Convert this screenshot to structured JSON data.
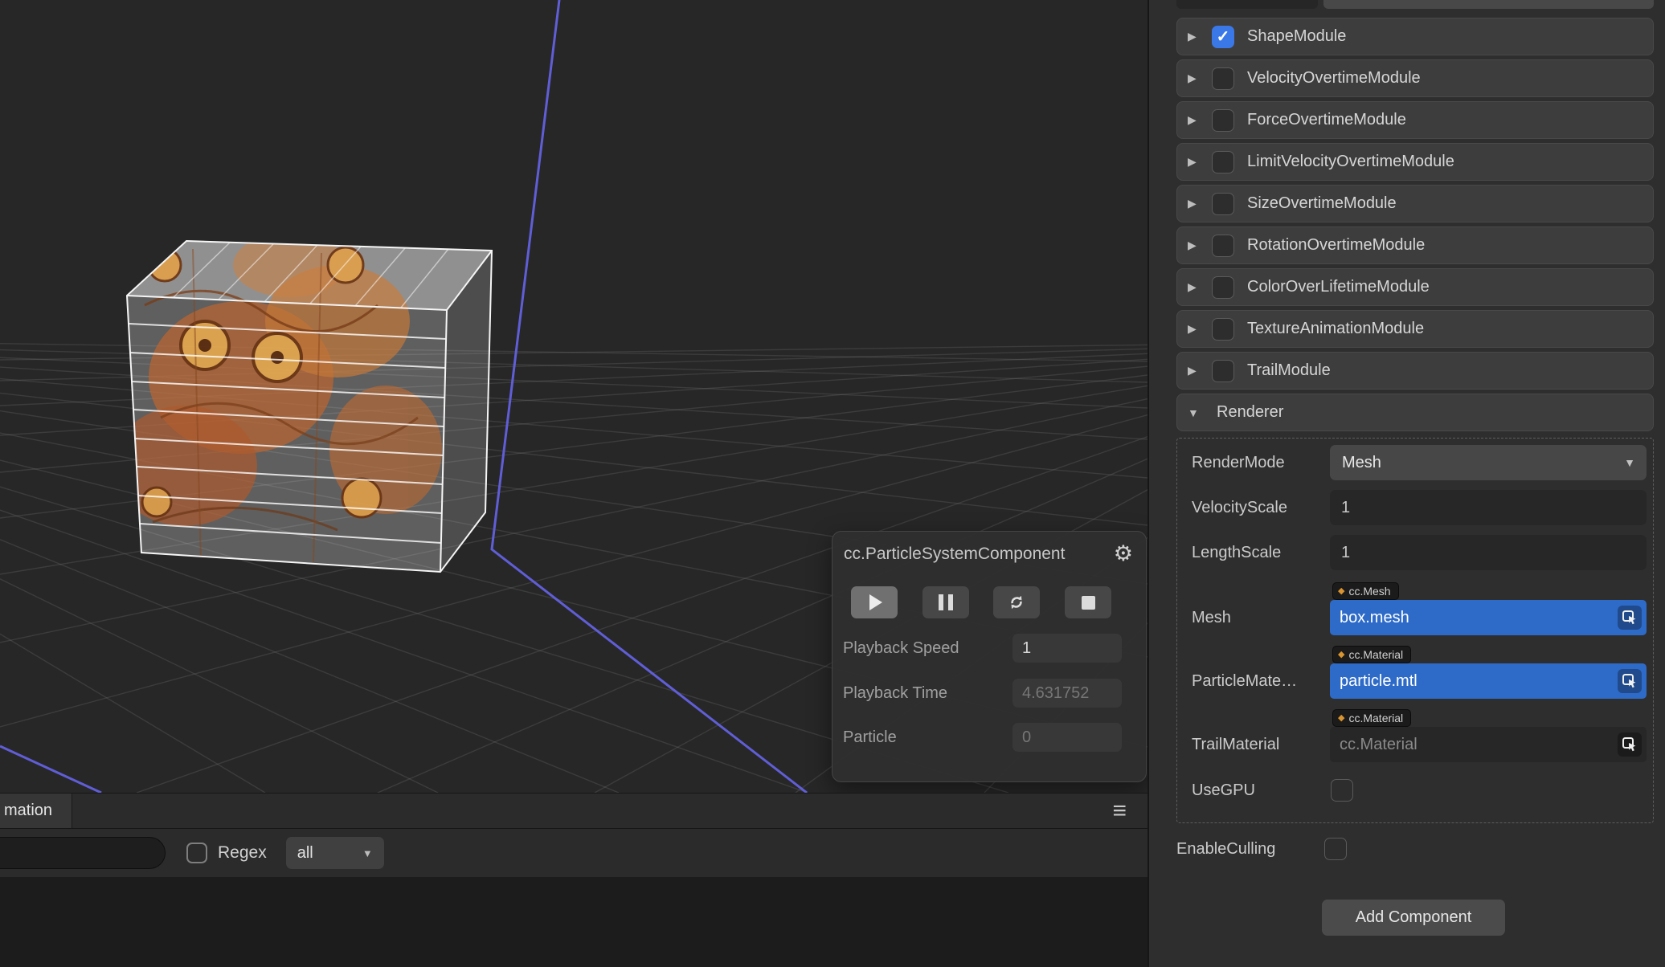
{
  "icons": {
    "check": "✓",
    "collapsed": "▶",
    "expanded": "▼",
    "gear": "⚙",
    "menu": "≡",
    "dropdown": "▼"
  },
  "colors": {
    "accent-blue": "#3b78e7",
    "selection-blue": "#2e6bc8",
    "diamond-orange": "#d9952f"
  },
  "inspector": {
    "modules": [
      {
        "label": "ShapeModule",
        "checked": true
      },
      {
        "label": "VelocityOvertimeModule",
        "checked": false
      },
      {
        "label": "ForceOvertimeModule",
        "checked": false
      },
      {
        "label": "LimitVelocityOvertimeModule",
        "checked": false
      },
      {
        "label": "SizeOvertimeModule",
        "checked": false
      },
      {
        "label": "RotationOvertimeModule",
        "checked": false
      },
      {
        "label": "ColorOverLifetimeModule",
        "checked": false
      },
      {
        "label": "TextureAnimationModule",
        "checked": false
      },
      {
        "label": "TrailModule",
        "checked": false
      }
    ],
    "renderer": {
      "header": "Renderer",
      "render_mode": {
        "label": "RenderMode",
        "value": "Mesh"
      },
      "velocity_scale": {
        "label": "VelocityScale",
        "value": "1"
      },
      "length_scale": {
        "label": "LengthScale",
        "value": "1"
      },
      "mesh": {
        "label": "Mesh",
        "type_tag": "cc.Mesh",
        "value": "box.mesh"
      },
      "particle_material": {
        "label": "ParticleMate…",
        "type_tag": "cc.Material",
        "value": "particle.mtl"
      },
      "trail_material": {
        "label": "TrailMaterial",
        "type_tag": "cc.Material",
        "value": "cc.Material"
      },
      "use_gpu": {
        "label": "UseGPU",
        "checked": false
      }
    },
    "enable_culling": {
      "label": "EnableCulling",
      "checked": false
    },
    "add_component_label": "Add Component"
  },
  "overlay": {
    "title": "cc.ParticleSystemComponent",
    "rows": [
      {
        "label": "Playback Speed",
        "value": "1"
      },
      {
        "label": "Playback Time",
        "value": "4.631752"
      },
      {
        "label": "Particle",
        "value": "0"
      }
    ]
  },
  "bottom_panel": {
    "tab_label": "mation",
    "search_value": "",
    "regex_label": "Regex",
    "filter_value": "all"
  }
}
